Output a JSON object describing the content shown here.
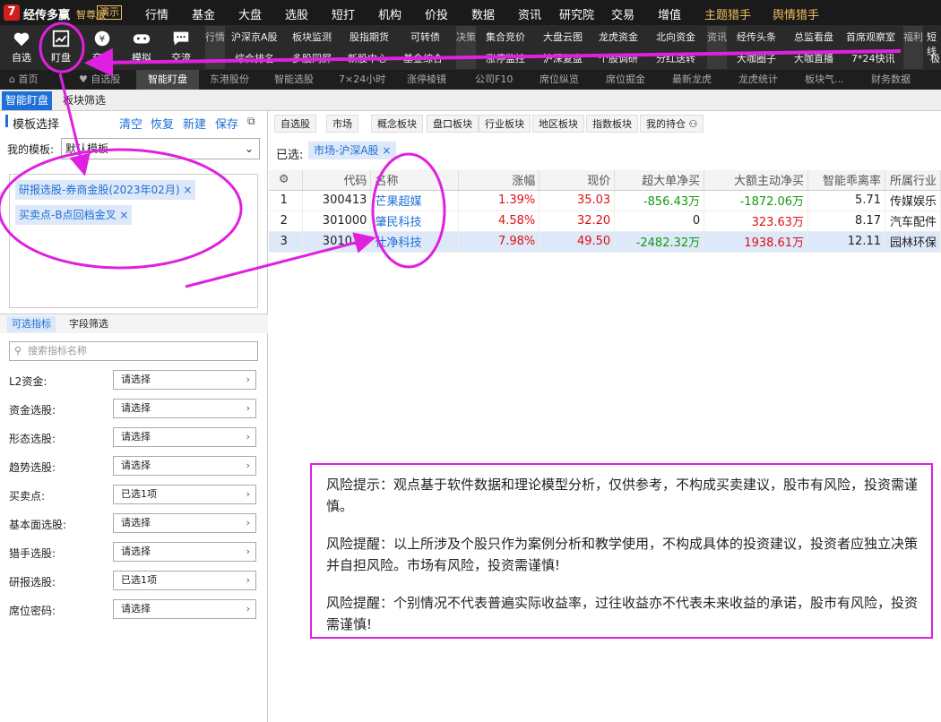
{
  "menubar": {
    "logo": "7",
    "app_name": "经传多赢",
    "edition": "智尊版",
    "demo": "演示",
    "items": [
      "行情",
      "基金",
      "大盘",
      "选股",
      "短打",
      "机构",
      "价投",
      "数据",
      "资讯",
      "研究院",
      "交易",
      "增值",
      "主题猎手",
      "舆情猎手"
    ]
  },
  "toolbar": {
    "buttons": [
      "自选",
      "盯盘",
      "交易",
      "模拟",
      "交流"
    ],
    "group1_label": "行情",
    "group1": [
      [
        "沪深京A股",
        "板块监测",
        "股指期货",
        "可转债"
      ],
      [
        "综合排名",
        "多股同屏",
        "新股中心",
        "基金综合"
      ]
    ],
    "group2_label": "决策",
    "group2": [
      [
        "集合竞价",
        "大盘云图",
        "龙虎资金",
        "北向资金"
      ],
      [
        "涨停监控",
        "沪深复盘",
        "个股调研",
        "分红送转"
      ]
    ],
    "group3_label": "资讯",
    "group3": [
      [
        "经传头条",
        "总监看盘",
        "首席观察室"
      ],
      [
        "大咖圈子",
        "大咖直播",
        "7*24快讯"
      ]
    ],
    "group4_label": "福利",
    "group4": [
      [
        "短线"
      ],
      [
        "极"
      ]
    ]
  },
  "nav2": [
    "首页",
    "自选股",
    "智能盯盘",
    "东港股份",
    "智能选股",
    "7×24小时",
    "涨停棱镜",
    "公司F10",
    "席位纵览",
    "席位掘金",
    "最新龙虎",
    "龙虎统计",
    "板块气...",
    "财务数据"
  ],
  "subtabs": [
    "智能盯盘",
    "板块筛选"
  ],
  "left": {
    "header": "模板选择",
    "links": [
      "清空",
      "恢复",
      "新建",
      "保存"
    ],
    "my_template_label": "我的模板:",
    "my_template_value": "默认模板",
    "tags": [
      "研报选股-券商金股(2023年02月)",
      "买卖点-B点回档金叉"
    ],
    "field_tabs": [
      "可选指标",
      "字段筛选"
    ],
    "search_placeholder": "搜索指标名称",
    "filters": [
      {
        "label": "L2资金:",
        "value": "请选择"
      },
      {
        "label": "资金选股:",
        "value": "请选择"
      },
      {
        "label": "形态选股:",
        "value": "请选择"
      },
      {
        "label": "趋势选股:",
        "value": "请选择"
      },
      {
        "label": "买卖点:",
        "value": "已选1项"
      },
      {
        "label": "基本面选股:",
        "value": "请选择"
      },
      {
        "label": "猎手选股:",
        "value": "请选择"
      },
      {
        "label": "研报选股:",
        "value": "已选1项"
      },
      {
        "label": "席位密码:",
        "value": "请选择"
      }
    ]
  },
  "right": {
    "cat_tabs": [
      "自选股",
      "市场",
      "概念板块",
      "盘口板块",
      "行业板块",
      "地区板块",
      "指数板块",
      "我的持仓"
    ],
    "selected_label": "已选:",
    "selected_chip": "市场-沪深A股",
    "columns": [
      "",
      "代码",
      "名称",
      "涨幅",
      "现价",
      "超大单净买",
      "大额主动净买",
      "智能乖离率",
      "所属行业"
    ],
    "rows": [
      [
        "1",
        "300413",
        "芒果超媒",
        "1.39%",
        "35.03",
        "-856.43万",
        "-1872.06万",
        "5.71",
        "传媒娱乐"
      ],
      [
        "2",
        "301000",
        "肇民科技",
        "4.58%",
        "32.20",
        "0",
        "323.63万",
        "8.17",
        "汽车配件"
      ],
      [
        "3",
        "301030",
        "仕净科技",
        "7.98%",
        "49.50",
        "-2482.32万",
        "1938.61万",
        "12.11",
        "园林环保"
      ]
    ]
  },
  "risk": [
    "风险提示：观点基于软件数据和理论模型分析，仅供参考，不构成买卖建议，股市有风险，投资需谨慎。",
    "风险提醒：以上所涉及个股只作为案例分析和教学使用，不构成具体的投资建议，投资者应独立决策并自担风险。市场有风险，投资需谨慎!",
    "风险提醒：个别情况不代表普遍实际收益率，过往收益亦不代表未来收益的承诺，股市有风险，投资需谨慎!"
  ],
  "colors": {
    "accent": "#1e6fd9",
    "annotation": "#e020e0",
    "up": "#e01010",
    "down": "#119911"
  }
}
